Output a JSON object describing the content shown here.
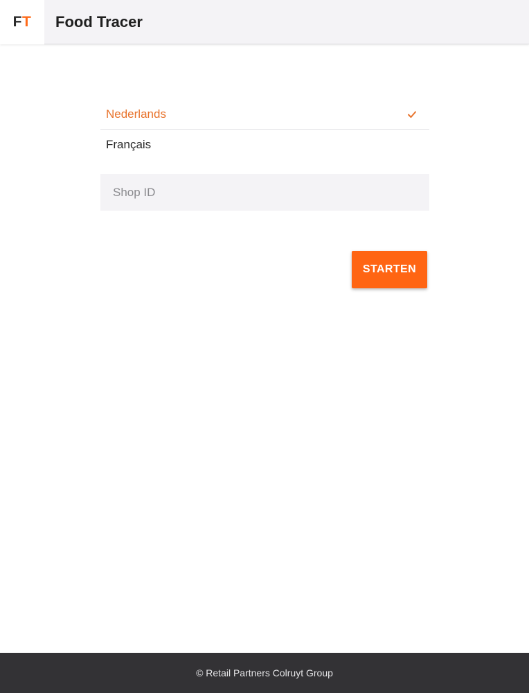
{
  "header": {
    "logo": {
      "letter_1": "F",
      "letter_2": "T"
    },
    "title": "Food Tracer"
  },
  "languages": [
    {
      "label": "Nederlands",
      "selected": true
    },
    {
      "label": "Français",
      "selected": false
    }
  ],
  "shop_id": {
    "placeholder": "Shop ID",
    "value": ""
  },
  "start_button": {
    "label": "STARTEN"
  },
  "footer": {
    "text": "© Retail Partners Colruyt Group"
  },
  "colors": {
    "accent": "#ff6513",
    "selected_text": "#e8732c",
    "header_bg": "#f4f3f6",
    "footer_bg": "#333235"
  },
  "icons": {
    "selected_marker": "check-icon"
  }
}
